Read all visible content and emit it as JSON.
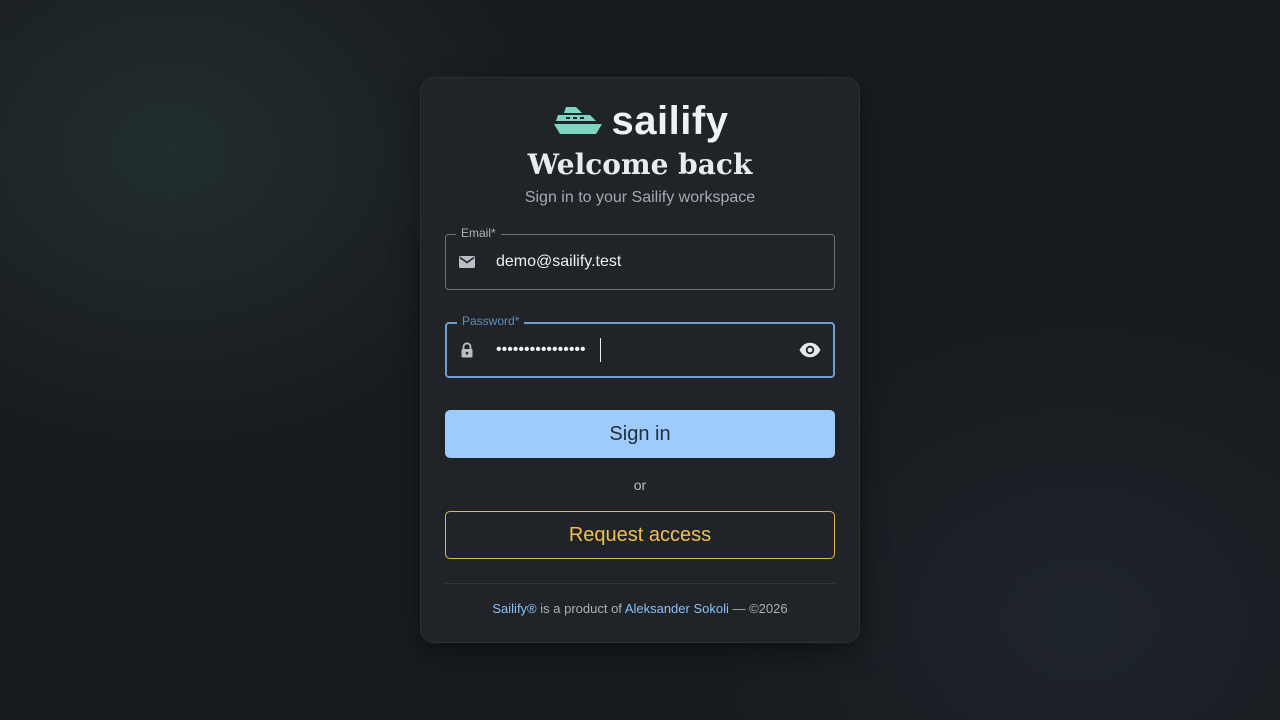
{
  "brand": {
    "name": "sailify",
    "logo_icon": "ship-icon",
    "accent_color": "#7fd6c0"
  },
  "header": {
    "title": "Welcome back",
    "subtitle": "Sign in to your Sailify workspace"
  },
  "form": {
    "email": {
      "label": "Email*",
      "value": "demo@sailify.test",
      "icon": "mail-icon"
    },
    "password": {
      "label": "Password*",
      "value": "••••••••••••••••",
      "icon": "lock-icon",
      "toggle_icon": "eye-icon"
    },
    "submit_label": "Sign in",
    "or_text": "or",
    "request_label": "Request access"
  },
  "footer": {
    "product": "Sailify®",
    "middle": " is a product of ",
    "author": "Aleksander Sokoli",
    "suffix": " — ©2026"
  },
  "colors": {
    "primary_button": "#9ecbfb",
    "secondary_border": "#e2b84a",
    "focus_border": "#6f9ed0",
    "link": "#8cc0f5"
  }
}
